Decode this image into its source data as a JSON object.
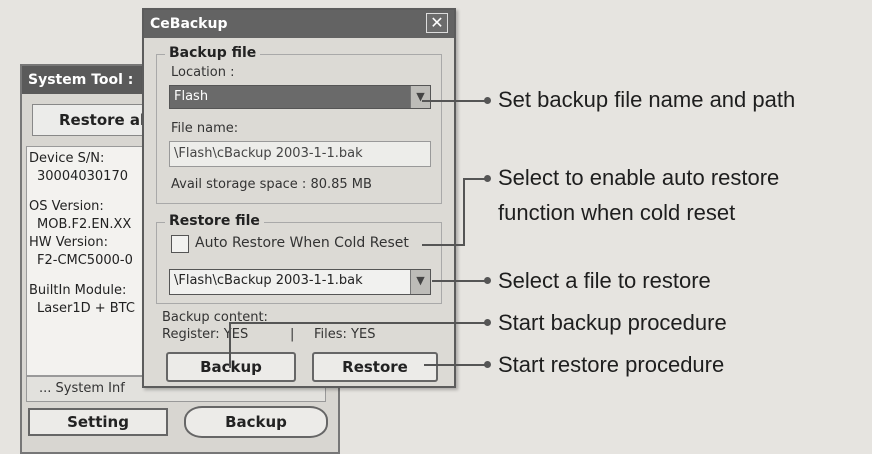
{
  "system_tool": {
    "title": "System Tool :",
    "restore_all_label": "Restore al",
    "info_lines": [
      "Device S/N:",
      "30004030170",
      "OS Version:",
      "MOB.F2.EN.XX",
      "HW Version:",
      "F2-CMC5000-0",
      "BuiltIn Module:",
      "Laser1D + BTC"
    ],
    "system_info_label": "... System Inf",
    "setting_label": "Setting",
    "backup_tab_label": "Backup"
  },
  "cebackup": {
    "title": "CeBackup",
    "close_glyph": "✕",
    "backup_group_title": "Backup file",
    "location_label": "Location :",
    "location_value": "Flash",
    "file_name_label": "File name:",
    "file_name_value": "\\Flash\\cBackup 2003-1-1.bak",
    "avail_storage": "Avail storage space : 80.85 MB",
    "restore_group_title": "Restore file",
    "auto_restore_label": "Auto Restore When Cold Reset",
    "auto_restore_checked": false,
    "restore_file_value": "\\Flash\\cBackup 2003-1-1.bak",
    "backup_content_label": "Backup content:",
    "register_label": "Register: YES",
    "separator": "|",
    "files_label": "Files: YES",
    "backup_button": "Backup",
    "restore_button": "Restore"
  },
  "callouts": [
    "Set backup file name and path",
    "Select to enable auto restore",
    "function when cold reset",
    "Select a file to restore",
    "Start backup procedure",
    "Start restore procedure"
  ],
  "colors": {
    "title_bar": "#636363",
    "selected_combo": "#6a6a6a",
    "background": "#e6e4e0"
  }
}
